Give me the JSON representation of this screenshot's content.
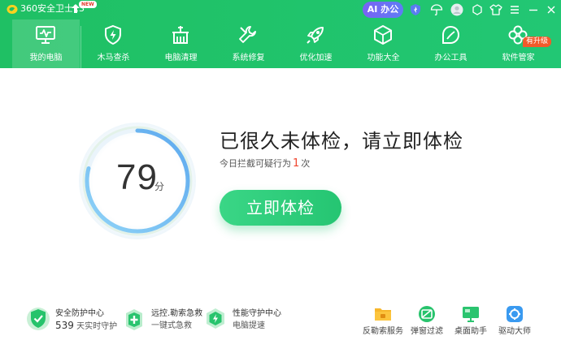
{
  "titlebar": {
    "app_title": "360安全卫士13",
    "new_badge": "NEW",
    "ai_button": "AI 办公",
    "icons": [
      "shield-badge-icon",
      "umbrella-icon",
      "user-avatar-icon",
      "skin-icon",
      "shirt-icon",
      "menu-icon",
      "minimize-icon",
      "close-icon"
    ]
  },
  "nav": {
    "items": [
      {
        "label": "我的电脑",
        "icon": "monitor-icon"
      },
      {
        "label": "木马查杀",
        "icon": "shield-bolt-icon"
      },
      {
        "label": "电脑清理",
        "icon": "broom-icon"
      },
      {
        "label": "系统修复",
        "icon": "wrench-icon"
      },
      {
        "label": "优化加速",
        "icon": "rocket-icon"
      },
      {
        "label": "功能大全",
        "icon": "cube-icon"
      },
      {
        "label": "办公工具",
        "icon": "leaf-icon"
      },
      {
        "label": "软件管家",
        "icon": "flower-icon"
      }
    ],
    "active_index": 0,
    "hot_badge": "有升级"
  },
  "main": {
    "score": "79",
    "score_unit": "分",
    "score_level": 0.79,
    "title": "已很久未体检，请立即体检",
    "sub_prefix": "今日拦截可疑行为",
    "sub_count": "1",
    "sub_suffix": "次",
    "check_button": "立即体检"
  },
  "bottom": {
    "features": [
      {
        "title": "安全防护中心",
        "sub_num": "539",
        "sub": "天实时守护"
      },
      {
        "title": "远控.勒索急救",
        "sub": "一键式急救"
      },
      {
        "title": "性能守护中心",
        "sub": "电脑提速"
      }
    ],
    "tools": [
      {
        "label": "反勒索服务"
      },
      {
        "label": "弹窗过滤"
      },
      {
        "label": "桌面助手"
      },
      {
        "label": "驱动大师"
      }
    ]
  },
  "colors": {
    "brand_green": "#20c36a",
    "accent_red": "#f0452e",
    "ai_purple": "#6e6ef4",
    "ring_blue": "#6aaef2"
  }
}
